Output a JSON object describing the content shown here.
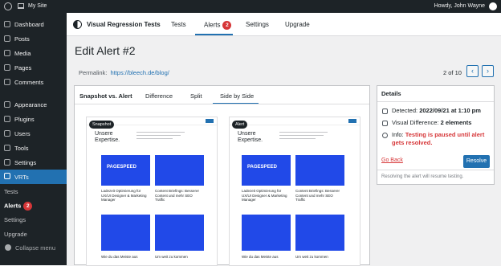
{
  "adminbar": {
    "site": "My Site",
    "howdy": "Howdy, John Wayne"
  },
  "sidebar": {
    "items": [
      {
        "label": "Dashboard",
        "icon": "dashboard-icon"
      },
      {
        "label": "Posts",
        "icon": "pin-icon"
      },
      {
        "label": "Media",
        "icon": "media-icon"
      },
      {
        "label": "Pages",
        "icon": "page-icon"
      },
      {
        "label": "Comments",
        "icon": "comment-icon"
      },
      {
        "label": "Appearance",
        "icon": "brush-icon"
      },
      {
        "label": "Plugins",
        "icon": "plugin-icon"
      },
      {
        "label": "Users",
        "icon": "user-icon"
      },
      {
        "label": "Tools",
        "icon": "wrench-icon"
      },
      {
        "label": "Settings",
        "icon": "settings-icon"
      },
      {
        "label": "VRTs",
        "icon": "vrts-icon"
      }
    ],
    "sub": [
      {
        "label": "Tests"
      },
      {
        "label": "Alerts",
        "badge": "2"
      },
      {
        "label": "Settings"
      },
      {
        "label": "Upgrade"
      }
    ],
    "collapse": "Collapse menu"
  },
  "topnav": {
    "title": "Visual Regression Tests",
    "tabs": [
      {
        "label": "Tests"
      },
      {
        "label": "Alerts",
        "badge": "2"
      },
      {
        "label": "Settings"
      },
      {
        "label": "Upgrade"
      }
    ]
  },
  "page": {
    "heading": "Edit Alert #2",
    "permalink_label": "Permalink:",
    "permalink": "https://bleech.de/blog/",
    "pager": "2 of 10"
  },
  "compare": {
    "title": "Snapshot vs. Alert",
    "tabs": [
      "Difference",
      "Split",
      "Side by Side"
    ],
    "left_label": "Snapshot",
    "right_label": "Alert",
    "site_heading": [
      "Unsere",
      "Expertise."
    ],
    "card1_title": "PAGESPEED",
    "card1_text": "Ladezeit Optimierung für UX/UI Designer & Marketing Manager",
    "card2_text": "Content Briefings: Besserer Content und mehr SEO Traffic",
    "card3_text": "Wie du das Meiste aus",
    "card4_text": "Um weit zu kommen"
  },
  "details": {
    "title": "Details",
    "detected_label": "Detected:",
    "detected": "2022/09/21 at 1:10 pm",
    "vdiff_label": "Visual Difference:",
    "vdiff": "2 elements",
    "info_label": "Info:",
    "info": "Testing is paused until alert gets resolved.",
    "go_back": "Go Back",
    "resolve": "Resolve",
    "note": "Resolving the alert will resume testing."
  },
  "colors": {
    "accent": "#2271b1",
    "danger": "#d63638",
    "admin_bg": "#1d2327",
    "card_blue": "#2149e8"
  }
}
